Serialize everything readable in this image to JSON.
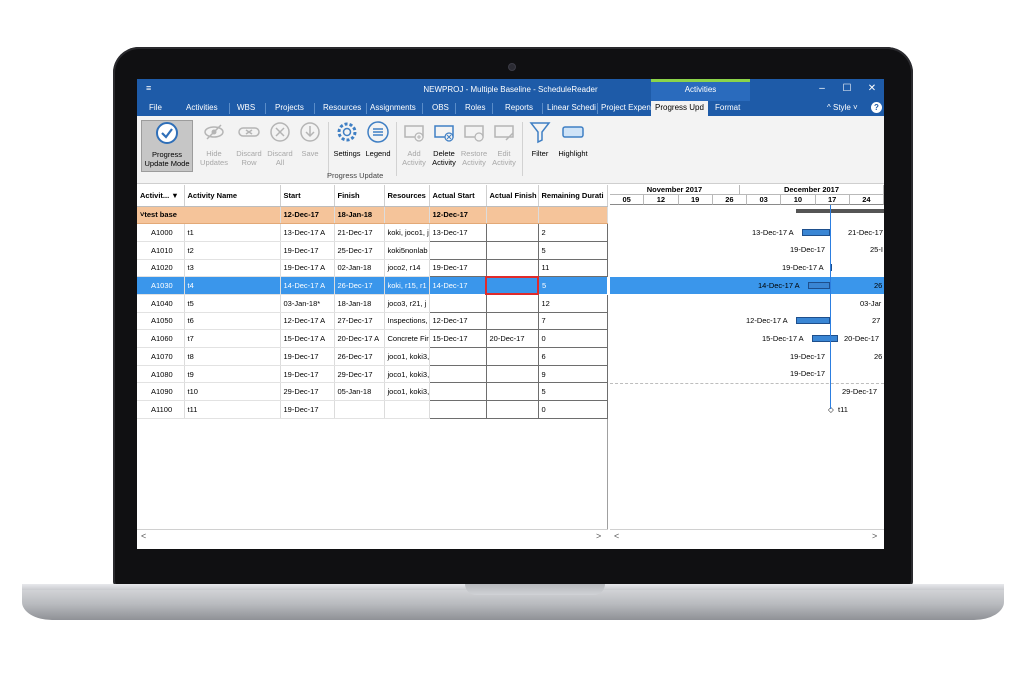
{
  "window": {
    "title": "NEWPROJ - Multiple Baseline - ScheduleReader",
    "context_tab": "Activities",
    "quick_access": "≡",
    "minimize": "–",
    "maximize": "☐",
    "close": "✕"
  },
  "menu": {
    "items": [
      "File",
      "Activities",
      "WBS",
      "Projects",
      "Resources",
      "Assignments",
      "OBS",
      "Roles",
      "Reports",
      "Linear Schedi",
      "Project Expen",
      "Progress Upd",
      "Format"
    ],
    "active_index": 11,
    "style_label": "^  Style  ˅",
    "help": "?"
  },
  "ribbon": {
    "buttons": [
      {
        "label": "Progress Update Mode",
        "state": "selected",
        "icon": "progress-check-icon"
      },
      {
        "label": "Hide Updates",
        "state": "disabled",
        "icon": "hide-eye-icon"
      },
      {
        "label": "Discard Row",
        "state": "disabled",
        "icon": "discard-row-icon"
      },
      {
        "label": "Discard All",
        "state": "disabled",
        "icon": "discard-all-icon"
      },
      {
        "label": "Save",
        "state": "disabled",
        "icon": "save-icon"
      },
      {
        "label": "Settings",
        "state": "enabled",
        "icon": "gear-icon"
      },
      {
        "label": "Legend",
        "state": "enabled",
        "icon": "legend-icon"
      },
      {
        "label": "Add Activity",
        "state": "disabled",
        "icon": "add-activity-icon"
      },
      {
        "label": "Delete Activity",
        "state": "enabled",
        "icon": "delete-activity-icon"
      },
      {
        "label": "Restore Activity",
        "state": "disabled",
        "icon": "restore-activity-icon"
      },
      {
        "label": "Edit Activity",
        "state": "disabled",
        "icon": "edit-activity-icon"
      },
      {
        "label": "Filter",
        "state": "enabled",
        "icon": "filter-icon"
      },
      {
        "label": "Highlight",
        "state": "enabled",
        "icon": "highlight-icon"
      }
    ],
    "group_label": "Progress Update"
  },
  "grid": {
    "columns": [
      "Activit...",
      "Activity Name",
      "Start",
      "Finish",
      "Resources",
      "Actual Start",
      "Actual Finish",
      "Remaining Durati"
    ],
    "sort_icon": "▼",
    "group": {
      "name": "test base",
      "start": "12-Dec-17",
      "finish": "18-Jan-18",
      "actual_start": "12-Dec-17",
      "toggle": "˅"
    },
    "rows": [
      {
        "id": "A1000",
        "name": "t1",
        "start": "13-Dec-17 A",
        "finish": "21-Dec-17",
        "resources": "koki, joco1, j",
        "actual_start": "13-Dec-17",
        "actual_finish": "",
        "remaining": "2"
      },
      {
        "id": "A1010",
        "name": "t2",
        "start": "19-Dec-17",
        "finish": "25-Dec-17",
        "resources": "koki5nonlab",
        "actual_start": "",
        "actual_finish": "",
        "remaining": "5"
      },
      {
        "id": "A1020",
        "name": "t3",
        "start": "19-Dec-17 A",
        "finish": "02-Jan-18",
        "resources": "joco2, r14",
        "actual_start": "19-Dec-17",
        "actual_finish": "",
        "remaining": "11"
      },
      {
        "id": "A1030",
        "name": "t4",
        "start": "14-Dec-17 A",
        "finish": "26-Dec-17",
        "resources": "koki, r15, r1",
        "actual_start": "14-Dec-17",
        "actual_finish": "",
        "remaining": "5"
      },
      {
        "id": "A1040",
        "name": "t5",
        "start": "03-Jan-18*",
        "finish": "18-Jan-18",
        "resources": "joco3, r21, j",
        "actual_start": "",
        "actual_finish": "",
        "remaining": "12"
      },
      {
        "id": "A1050",
        "name": "t6",
        "start": "12-Dec-17 A",
        "finish": "27-Dec-17",
        "resources": "Inspections,",
        "actual_start": "12-Dec-17",
        "actual_finish": "",
        "remaining": "7"
      },
      {
        "id": "A1060",
        "name": "t7",
        "start": "15-Dec-17 A",
        "finish": "20-Dec-17 A",
        "resources": "Concrete Fir",
        "actual_start": "15-Dec-17",
        "actual_finish": "20-Dec-17",
        "remaining": "0"
      },
      {
        "id": "A1070",
        "name": "t8",
        "start": "19-Dec-17",
        "finish": "26-Dec-17",
        "resources": "joco1, koki3,",
        "actual_start": "",
        "actual_finish": "",
        "remaining": "6"
      },
      {
        "id": "A1080",
        "name": "t9",
        "start": "19-Dec-17",
        "finish": "29-Dec-17",
        "resources": "joco1, koki3,",
        "actual_start": "",
        "actual_finish": "",
        "remaining": "9"
      },
      {
        "id": "A1090",
        "name": "t10",
        "start": "29-Dec-17",
        "finish": "05-Jan-18",
        "resources": "joco1, koki3,",
        "actual_start": "",
        "actual_finish": "",
        "remaining": "5"
      },
      {
        "id": "A1100",
        "name": "t11",
        "start": "19-Dec-17",
        "finish": "",
        "resources": "",
        "actual_start": "",
        "actual_finish": "",
        "remaining": "0"
      }
    ],
    "selected_index": 3
  },
  "gantt": {
    "months": [
      "November 2017",
      "December 2017"
    ],
    "weeks": [
      "05",
      "12",
      "19",
      "26",
      "03",
      "10",
      "17",
      "24"
    ],
    "rows": [
      {
        "left_label": "13-Dec-17 A",
        "right_label": "21-Dec-17"
      },
      {
        "left_label": "19-Dec-17",
        "right_label": "25-I"
      },
      {
        "left_label": "19-Dec-17 A",
        "right_label": ""
      },
      {
        "left_label": "14-Dec-17 A",
        "right_label": "26"
      },
      {
        "left_label": "",
        "right_label": "03-Jar"
      },
      {
        "left_label": "12-Dec-17 A",
        "right_label": "27"
      },
      {
        "left_label": "15-Dec-17 A",
        "right_label": "20-Dec-17"
      },
      {
        "left_label": "19-Dec-17",
        "right_label": "26"
      },
      {
        "left_label": "19-Dec-17",
        "right_label": ""
      },
      {
        "left_label": "",
        "right_label": "29-Dec-17"
      },
      {
        "left_label": "",
        "right_label": "t11"
      }
    ]
  },
  "scroll": {
    "left": "<",
    "right": ">"
  }
}
